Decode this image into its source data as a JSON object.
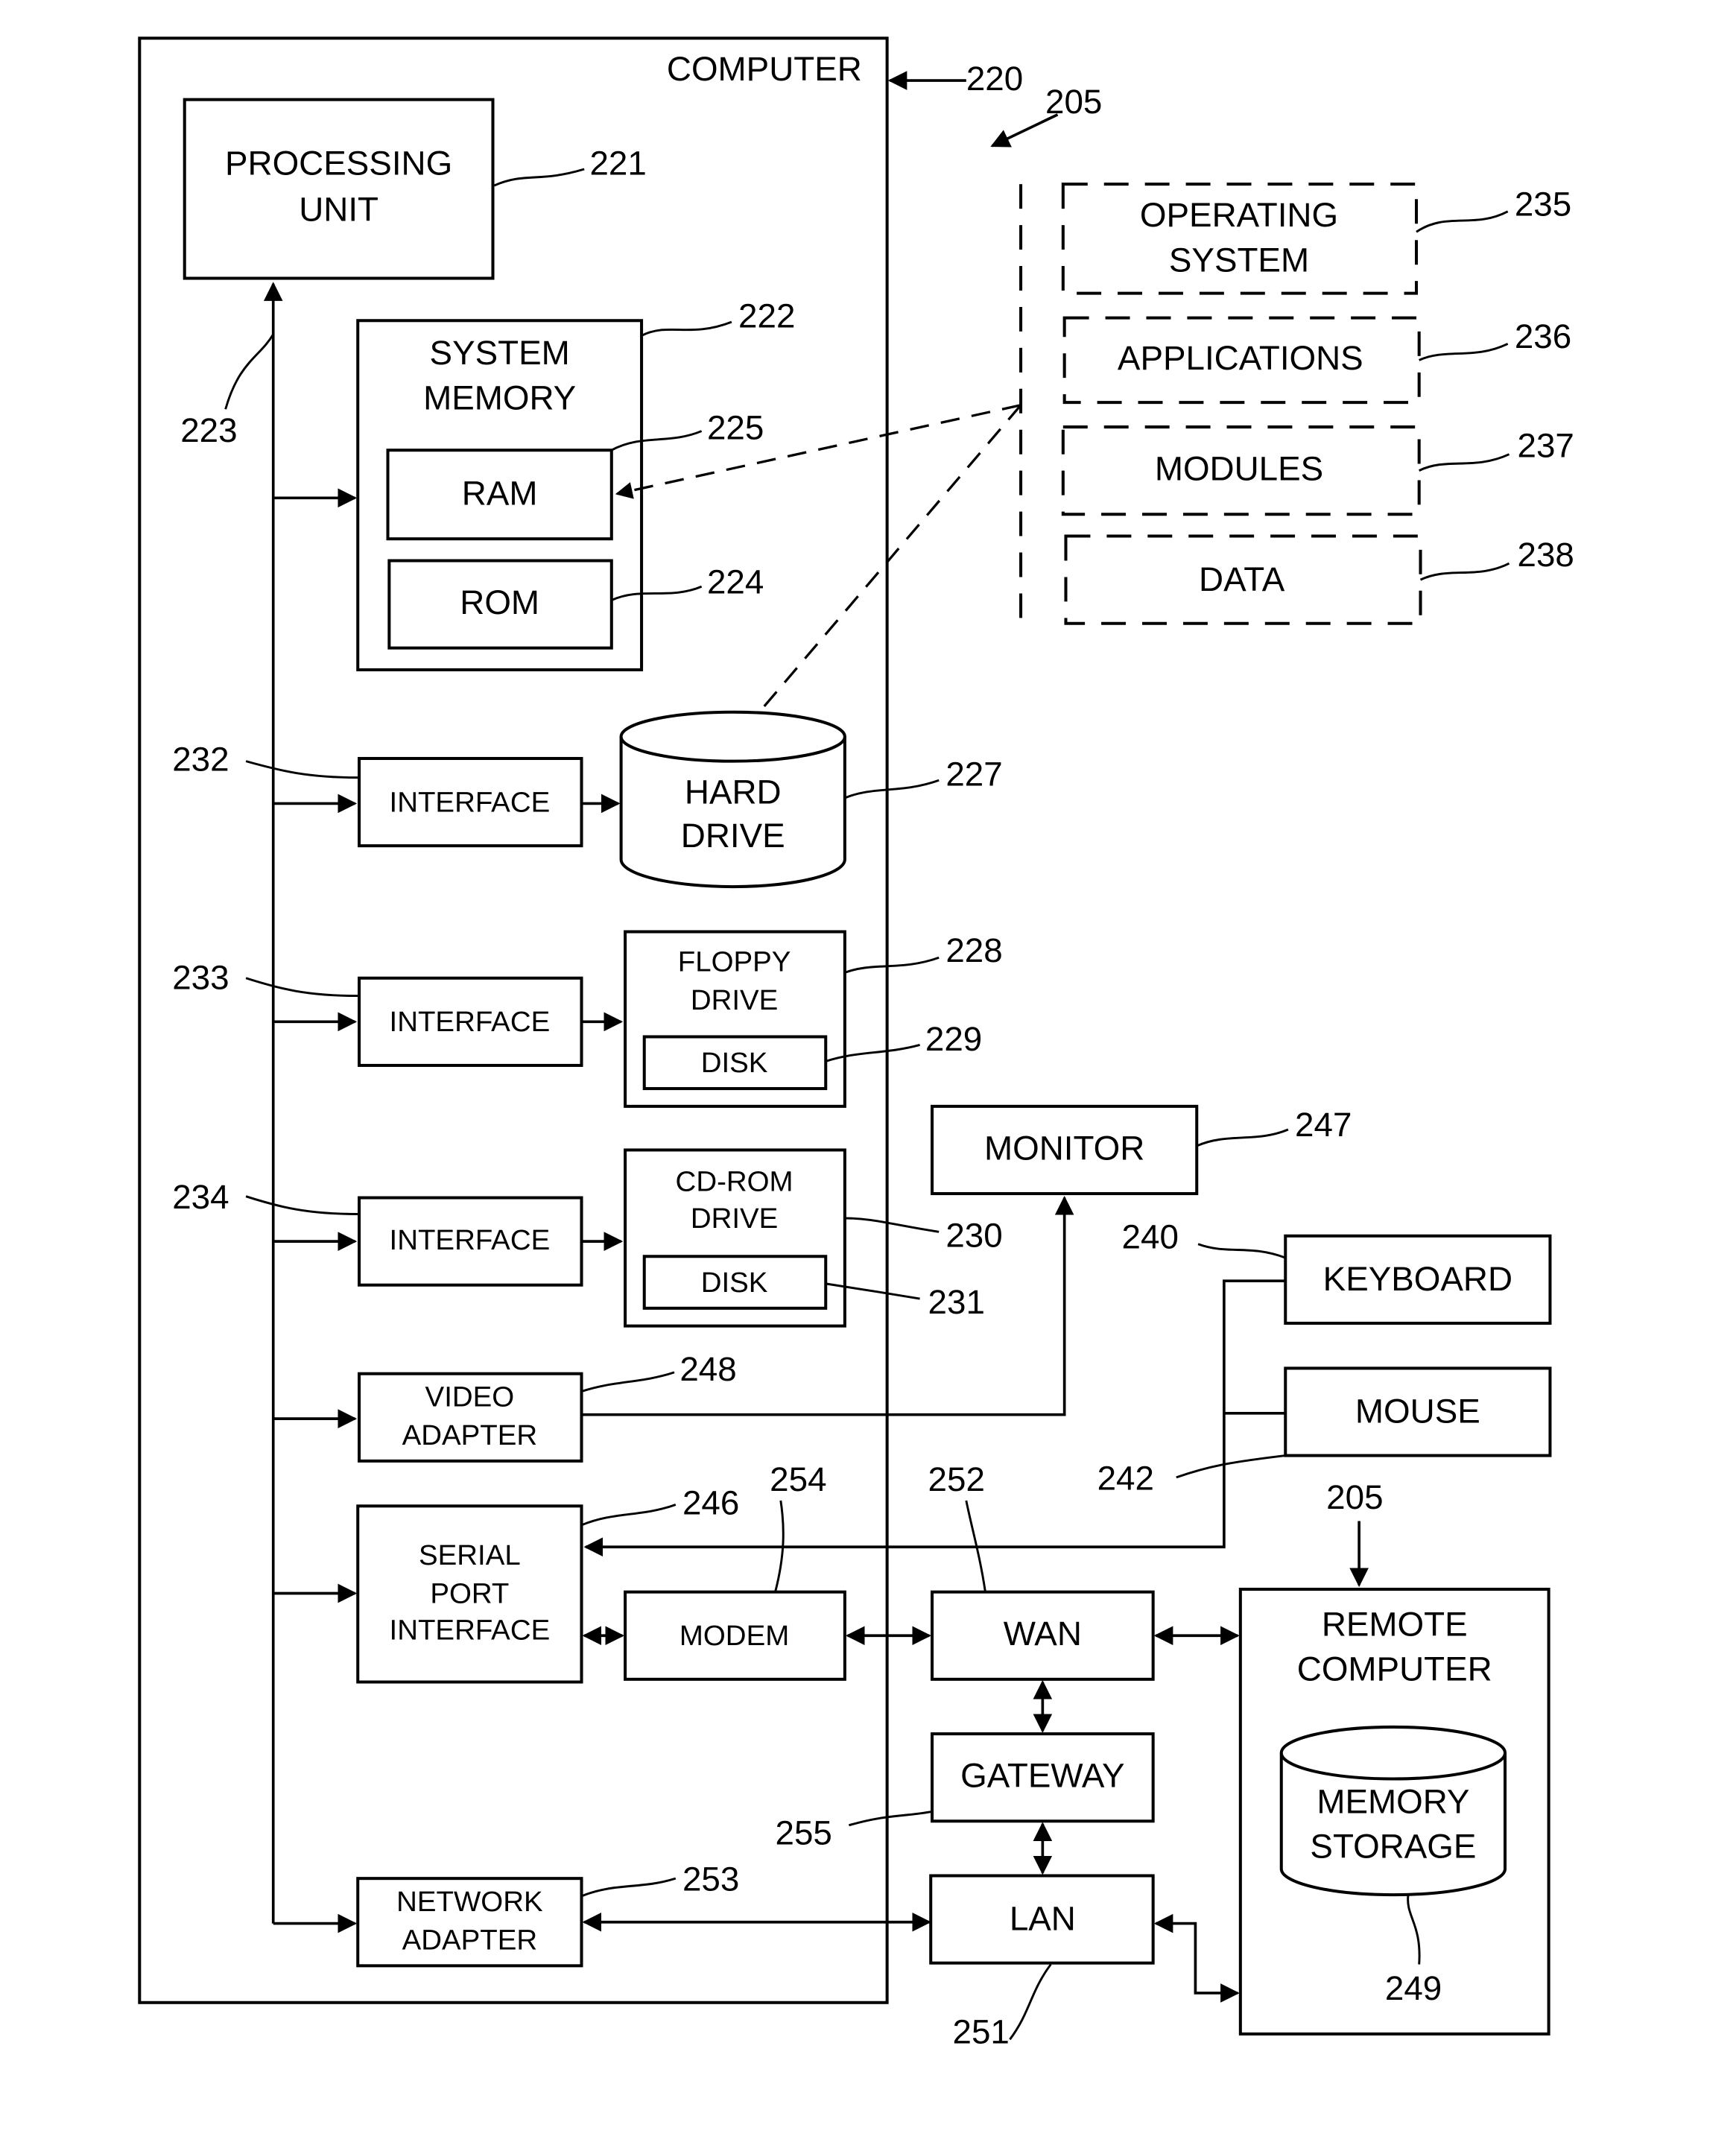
{
  "diagram": {
    "computer": {
      "label": "COMPUTER",
      "ref": "220"
    },
    "system_ref": "205",
    "processing_unit": {
      "lines": [
        "PROCESSING",
        "UNIT"
      ],
      "ref": "221"
    },
    "bus": {
      "ref": "223"
    },
    "system_memory": {
      "lines": [
        "SYSTEM",
        "MEMORY"
      ],
      "ref": "222"
    },
    "ram": {
      "label": "RAM",
      "ref": "225"
    },
    "rom": {
      "label": "ROM",
      "ref": "224"
    },
    "interface_hd": {
      "label": "INTERFACE",
      "ref": "232"
    },
    "hard_drive": {
      "lines": [
        "HARD",
        "DRIVE"
      ],
      "ref": "227"
    },
    "interface_fd": {
      "label": "INTERFACE",
      "ref": "233"
    },
    "floppy_drive": {
      "lines": [
        "FLOPPY",
        "DRIVE"
      ],
      "ref": "228"
    },
    "floppy_disk": {
      "label": "DISK",
      "ref": "229"
    },
    "interface_cd": {
      "label": "INTERFACE",
      "ref": "234"
    },
    "cdrom_drive": {
      "lines": [
        "CD-ROM",
        "DRIVE"
      ],
      "ref": "230"
    },
    "cd_disk": {
      "label": "DISK",
      "ref": "231"
    },
    "video_adapter": {
      "lines": [
        "VIDEO",
        "ADAPTER"
      ],
      "ref": "248"
    },
    "serial_port": {
      "lines": [
        "SERIAL",
        "PORT",
        "INTERFACE"
      ],
      "ref": "246"
    },
    "modem": {
      "label": "MODEM",
      "ref": "254"
    },
    "network_adapter": {
      "lines": [
        "NETWORK",
        "ADAPTER"
      ],
      "ref": "253"
    },
    "operating_system": {
      "lines": [
        "OPERATING",
        "SYSTEM"
      ],
      "ref": "235"
    },
    "applications": {
      "label": "APPLICATIONS",
      "ref": "236"
    },
    "modules": {
      "label": "MODULES",
      "ref": "237"
    },
    "data": {
      "label": "DATA",
      "ref": "238"
    },
    "monitor": {
      "label": "MONITOR",
      "ref": "247"
    },
    "keyboard": {
      "label": "KEYBOARD",
      "ref": "240"
    },
    "mouse": {
      "label": "MOUSE",
      "ref": "242"
    },
    "wan": {
      "label": "WAN",
      "ref": "252"
    },
    "gateway": {
      "label": "GATEWAY",
      "ref": "255"
    },
    "lan": {
      "label": "LAN",
      "ref": "251"
    },
    "remote_computer": {
      "lines": [
        "REMOTE",
        "COMPUTER"
      ],
      "ref": "205"
    },
    "memory_storage": {
      "lines": [
        "MEMORY",
        "STORAGE"
      ],
      "ref": "249"
    }
  }
}
